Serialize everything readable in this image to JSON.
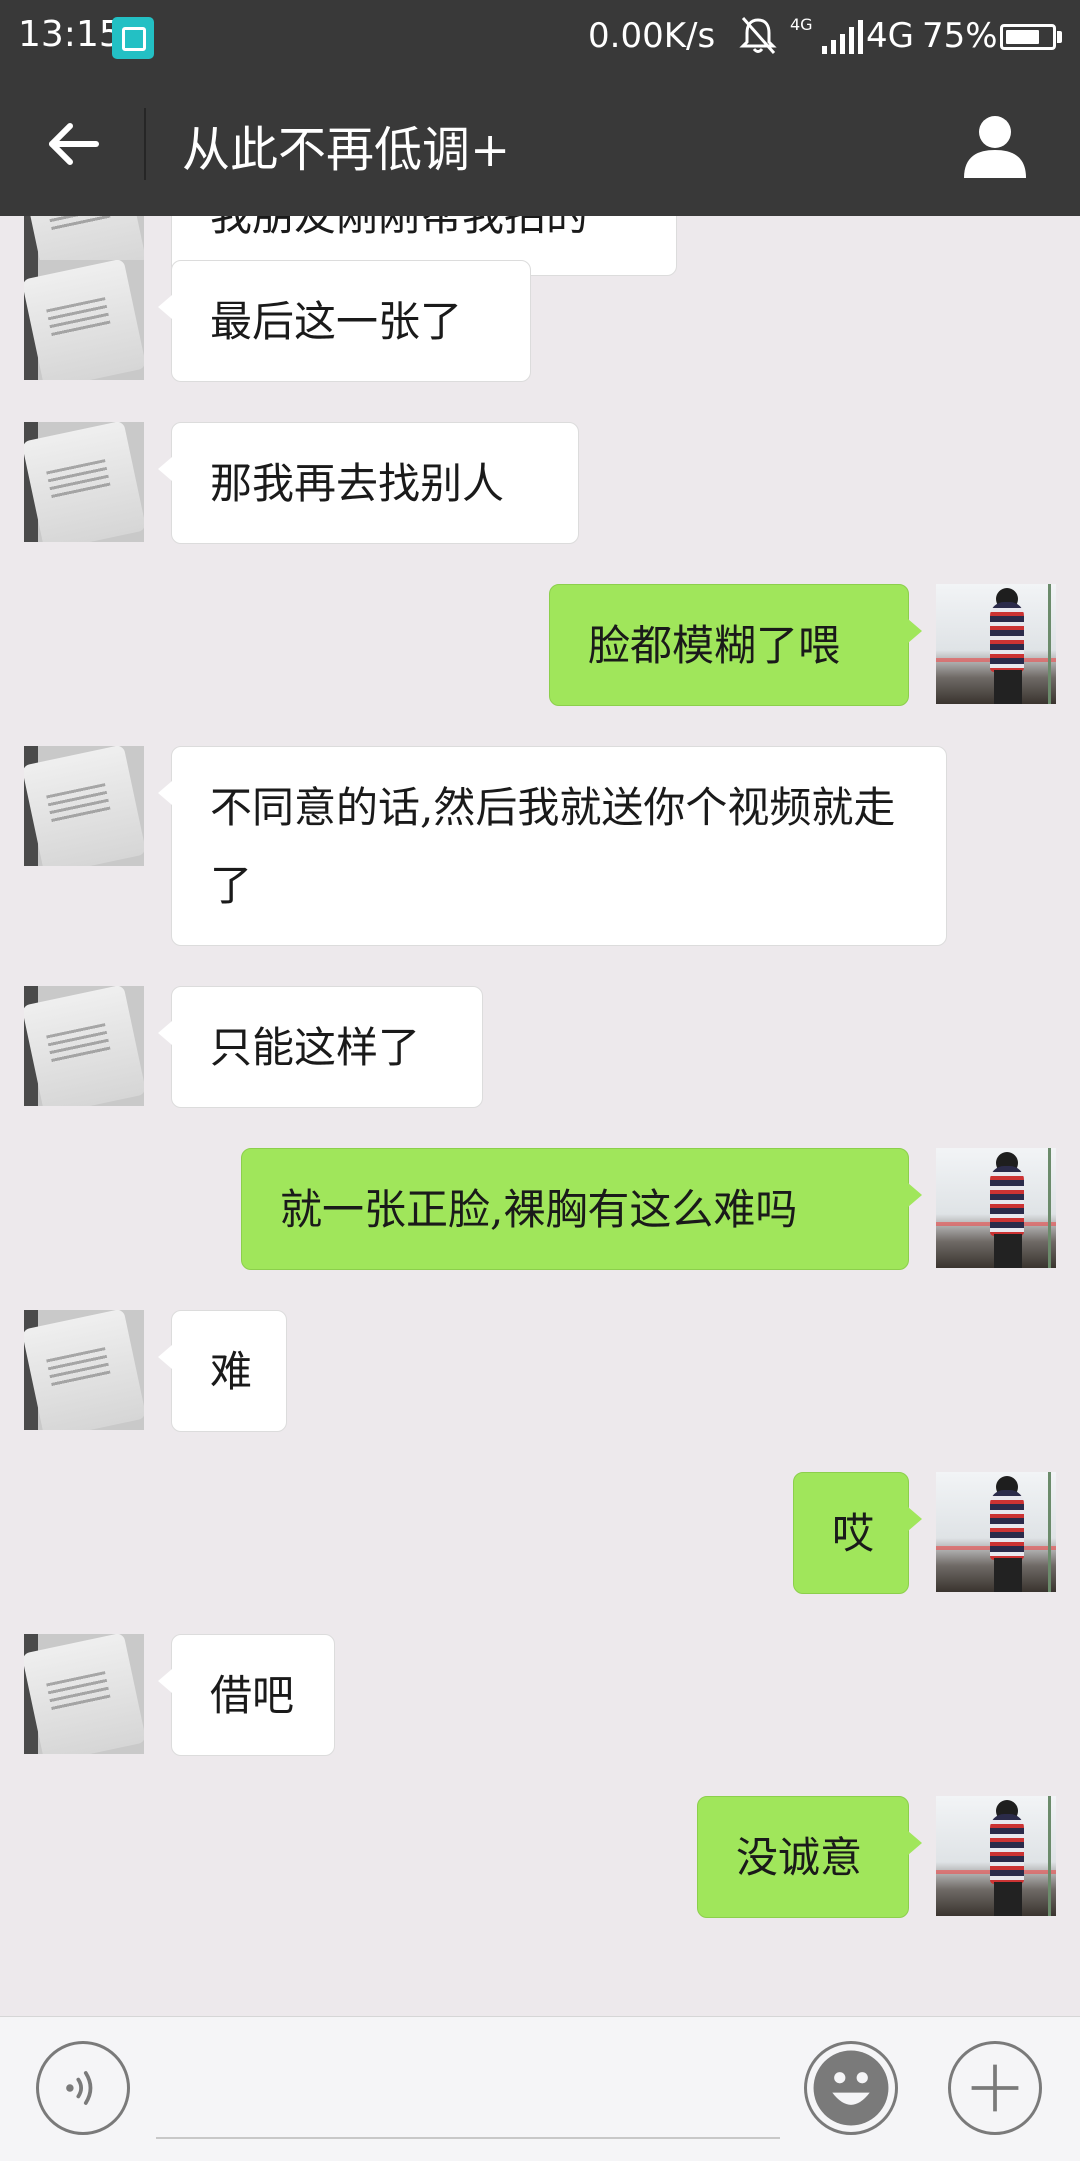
{
  "status_bar": {
    "time": "13:15",
    "network_speed": "0.00K/s",
    "network_type_small": "4G",
    "network_type": "4G",
    "battery_percent_text": "75%",
    "battery_level": 0.75,
    "icons": [
      "screenshot-app-icon",
      "mute-bell-icon",
      "signal-icon",
      "battery-icon"
    ]
  },
  "header": {
    "title": "从此不再低调+",
    "icons": [
      "back-arrow-icon",
      "profile-icon"
    ]
  },
  "messages": [
    {
      "side": "left",
      "text": "我朋友刚刚帮我拍的"
    },
    {
      "side": "left",
      "text": "最后这一张了"
    },
    {
      "side": "left",
      "text": "那我再去找别人"
    },
    {
      "side": "right",
      "text": "脸都模糊了喂"
    },
    {
      "side": "left",
      "text": "不同意的话,然后我就送你个视频就走了"
    },
    {
      "side": "left",
      "text": "只能这样了"
    },
    {
      "side": "right",
      "text": "就一张正脸,裸胸有这么难吗"
    },
    {
      "side": "left",
      "text": "难"
    },
    {
      "side": "right",
      "text": "哎"
    },
    {
      "side": "left",
      "text": "借吧"
    },
    {
      "side": "right",
      "text": "没诚意"
    }
  ],
  "input_bar": {
    "placeholder": "",
    "icons": [
      "voice-icon",
      "emoji-icon",
      "plus-icon"
    ]
  },
  "colors": {
    "top_bar": "#393939",
    "chat_background": "#ede9ec",
    "incoming_bubble": "#ffffff",
    "outgoing_bubble": "#a0e65b"
  }
}
